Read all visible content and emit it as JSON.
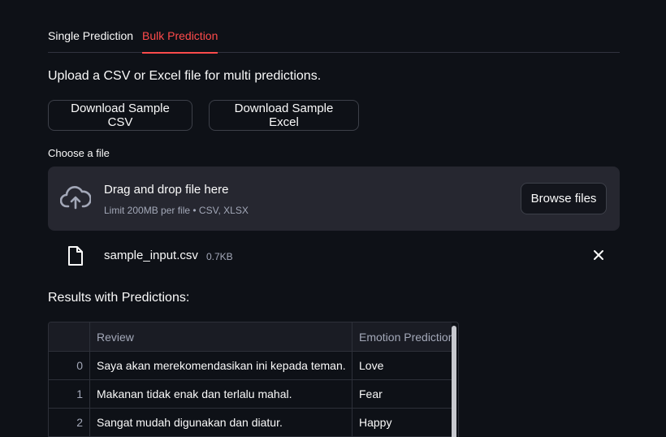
{
  "tabs": [
    {
      "label": "Single Prediction",
      "active": false
    },
    {
      "label": "Bulk Prediction",
      "active": true
    }
  ],
  "intro_text": "Upload a CSV or Excel file for multi predictions.",
  "buttons": {
    "download_csv": "Download Sample CSV",
    "download_excel": "Download Sample Excel"
  },
  "uploader": {
    "label": "Choose a file",
    "title": "Drag and drop file here",
    "limit": "Limit 200MB per file • CSV, XLSX",
    "browse_label": "Browse files"
  },
  "uploaded_file": {
    "name": "sample_input.csv",
    "size": "0.7KB"
  },
  "results_title": "Results with Predictions:",
  "table": {
    "columns": [
      "",
      "Review",
      "Emotion Prediction"
    ],
    "rows": [
      {
        "index": "0",
        "review": "Saya akan merekomendasikan ini kepada teman.",
        "emotion": "Love"
      },
      {
        "index": "1",
        "review": "Makanan tidak enak dan terlalu mahal.",
        "emotion": "Fear"
      },
      {
        "index": "2",
        "review": "Sangat mudah digunakan dan diatur.",
        "emotion": "Happy"
      }
    ]
  },
  "colors": {
    "background": "#0e1117",
    "accent": "#ff4b4b",
    "surface": "#262730"
  }
}
